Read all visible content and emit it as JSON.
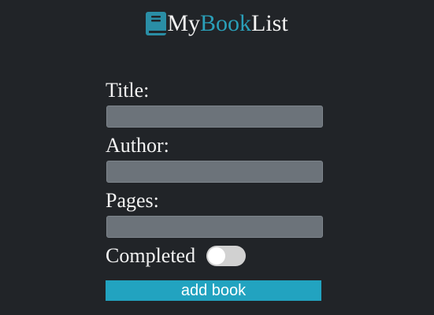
{
  "header": {
    "logo_icon": "book-icon",
    "title_part1": "My",
    "title_part2": "Book",
    "title_part3": "List",
    "accent_color": "#2a9fb8"
  },
  "form": {
    "title_label": "Title:",
    "title_value": "",
    "author_label": "Author:",
    "author_value": "",
    "pages_label": "Pages:",
    "pages_value": "",
    "completed_label": "Completed",
    "completed": false,
    "submit_label": "add book",
    "button_color": "#22a3c0"
  }
}
